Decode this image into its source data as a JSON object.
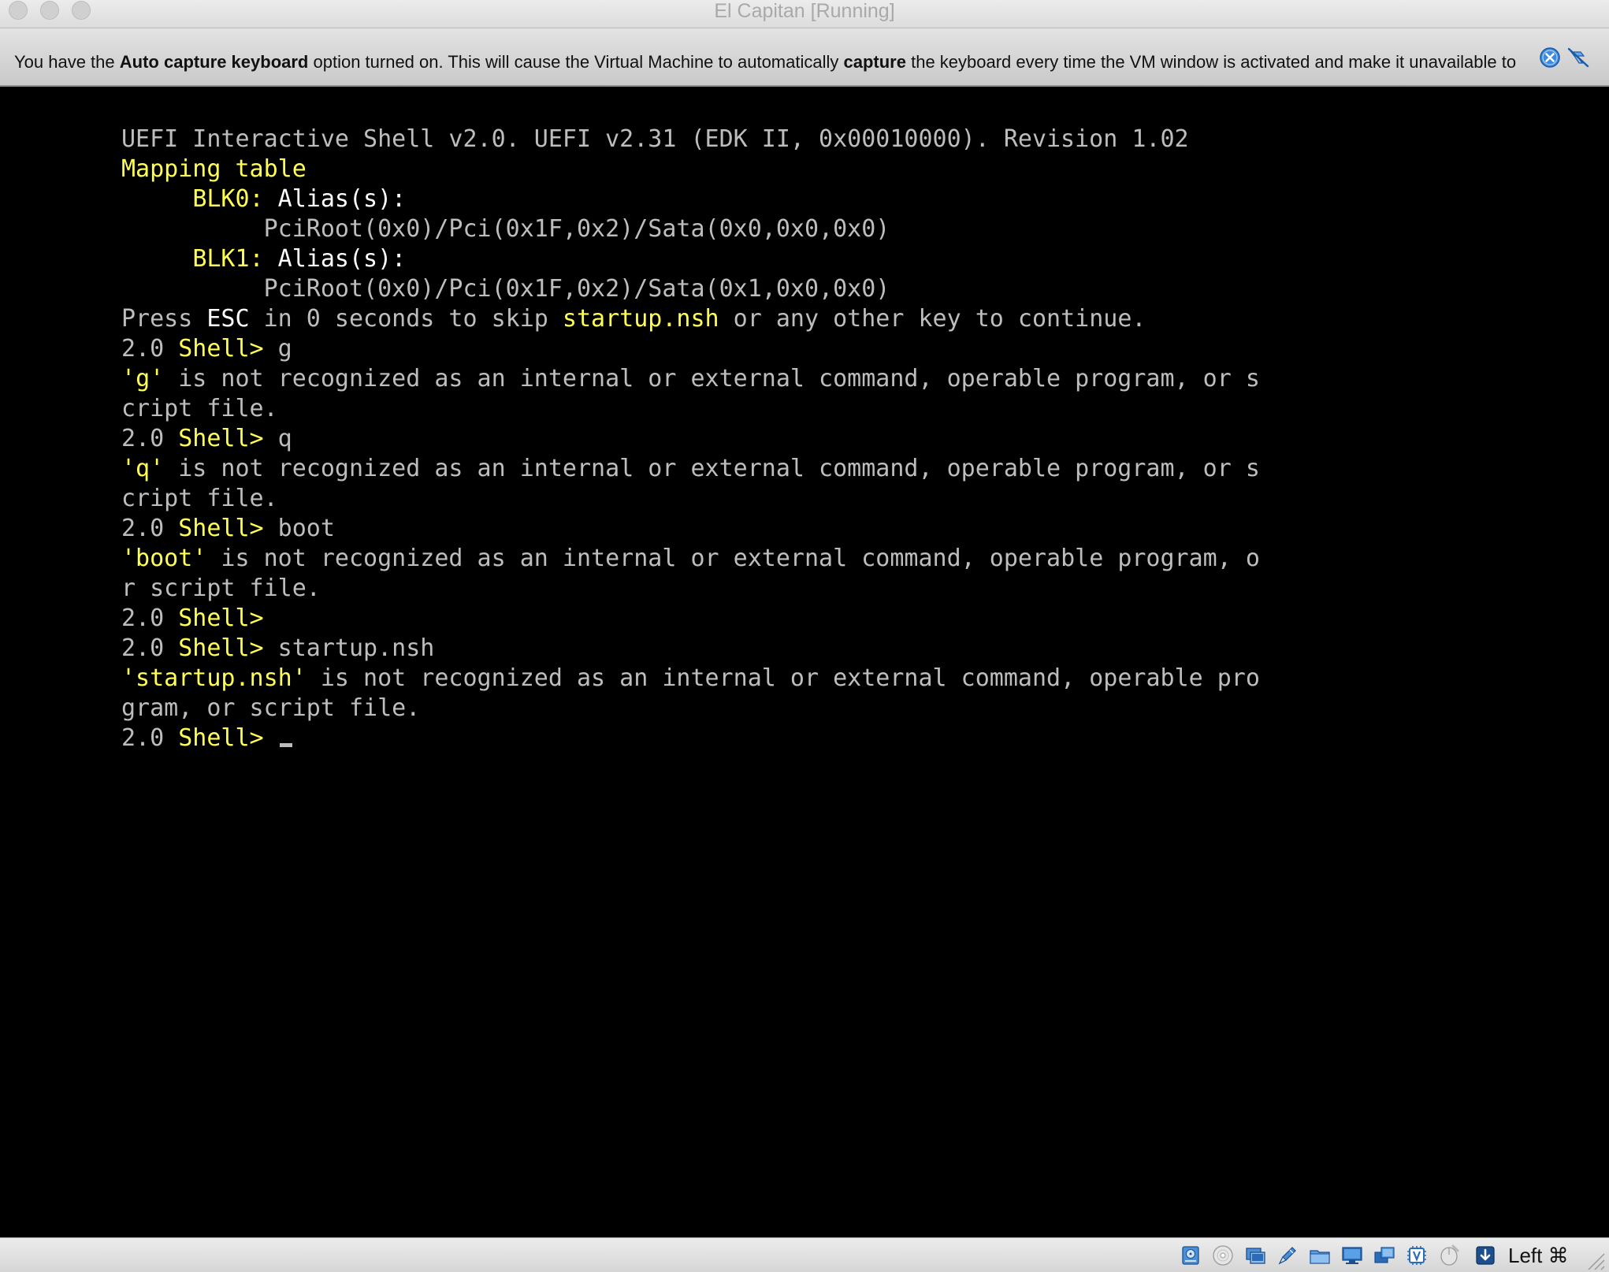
{
  "window": {
    "title": "El Capitan [Running]"
  },
  "banner": {
    "segments": [
      {
        "text": "You have the ",
        "bold": false
      },
      {
        "text": "Auto capture keyboard",
        "bold": true
      },
      {
        "text": " option turned on. This will cause the Virtual Machine to automatically ",
        "bold": false
      },
      {
        "text": "capture",
        "bold": true
      },
      {
        "text": " the keyboard every time the VM window is activated and make it unavailable to",
        "bold": false
      }
    ],
    "icons": [
      "close-message-icon",
      "do-not-show-again-icon"
    ]
  },
  "console": {
    "lines": [
      [
        {
          "t": "UEFI Interactive Shell v2.0. UEFI v2.31 (EDK II, 0x00010000). Revision 1.02",
          "c": "g"
        }
      ],
      [
        {
          "t": "Mapping table",
          "c": "y"
        }
      ],
      [
        {
          "t": "     ",
          "c": "g"
        },
        {
          "t": "BLK0:",
          "c": "y"
        },
        {
          "t": " Alias(s):",
          "c": "w"
        }
      ],
      [
        {
          "t": "          PciRoot(0x0)/Pci(0x1F,0x2)/Sata(0x0,0x0,0x0)",
          "c": "g"
        }
      ],
      [
        {
          "t": "     ",
          "c": "g"
        },
        {
          "t": "BLK1:",
          "c": "y"
        },
        {
          "t": " Alias(s):",
          "c": "w"
        }
      ],
      [
        {
          "t": "          PciRoot(0x0)/Pci(0x1F,0x2)/Sata(0x1,0x0,0x0)",
          "c": "g"
        }
      ],
      [
        {
          "t": "Press ",
          "c": "g"
        },
        {
          "t": "ESC",
          "c": "w"
        },
        {
          "t": " in 0 seconds to skip ",
          "c": "g"
        },
        {
          "t": "startup.nsh",
          "c": "y"
        },
        {
          "t": " or any other key to continue.",
          "c": "g"
        }
      ],
      [
        {
          "t": "2.0 ",
          "c": "g"
        },
        {
          "t": "Shell>",
          "c": "y"
        },
        {
          "t": " g",
          "c": "g"
        }
      ],
      [
        {
          "t": "'",
          "c": "y"
        },
        {
          "t": "g",
          "c": "y"
        },
        {
          "t": "'",
          "c": "y"
        },
        {
          "t": " is not recognized as an internal or external command, operable program, or s",
          "c": "g"
        }
      ],
      [
        {
          "t": "cript file.",
          "c": "g"
        }
      ],
      [
        {
          "t": "2.0 ",
          "c": "g"
        },
        {
          "t": "Shell>",
          "c": "y"
        },
        {
          "t": " q",
          "c": "g"
        }
      ],
      [
        {
          "t": "'q'",
          "c": "y"
        },
        {
          "t": " is not recognized as an internal or external command, operable program, or s",
          "c": "g"
        }
      ],
      [
        {
          "t": "cript file.",
          "c": "g"
        }
      ],
      [
        {
          "t": "2.0 ",
          "c": "g"
        },
        {
          "t": "Shell>",
          "c": "y"
        },
        {
          "t": " boot",
          "c": "g"
        }
      ],
      [
        {
          "t": "'boot'",
          "c": "y"
        },
        {
          "t": " is not recognized as an internal or external command, operable program, o",
          "c": "g"
        }
      ],
      [
        {
          "t": "r script file.",
          "c": "g"
        }
      ],
      [
        {
          "t": "2.0 ",
          "c": "g"
        },
        {
          "t": "Shell>",
          "c": "y"
        }
      ],
      [
        {
          "t": "2.0 ",
          "c": "g"
        },
        {
          "t": "Shell>",
          "c": "y"
        },
        {
          "t": " startup.nsh",
          "c": "g"
        }
      ],
      [
        {
          "t": "'startup.nsh'",
          "c": "y"
        },
        {
          "t": " is not recognized as an internal or external command, operable pro",
          "c": "g"
        }
      ],
      [
        {
          "t": "gram, or script file.",
          "c": "g"
        }
      ],
      [
        {
          "t": "2.0 ",
          "c": "g"
        },
        {
          "t": "Shell>",
          "c": "y"
        },
        {
          "t": " ",
          "c": "g"
        }
      ]
    ],
    "colors": {
      "yellow": "#ffff55",
      "white": "#ffffff",
      "gray": "#bdbdbd",
      "background": "#000000"
    }
  },
  "statusbar": {
    "icons": [
      "hard-disk-icon",
      "optical-drive-icon",
      "audio-icon",
      "network-icon",
      "usb-icon",
      "shared-folders-icon",
      "display-icon",
      "video-capture-icon",
      "cpu-virtualization-icon",
      "mouse-integration-icon",
      "keyboard-capture-icon"
    ],
    "host_key": "Left ⌘"
  }
}
